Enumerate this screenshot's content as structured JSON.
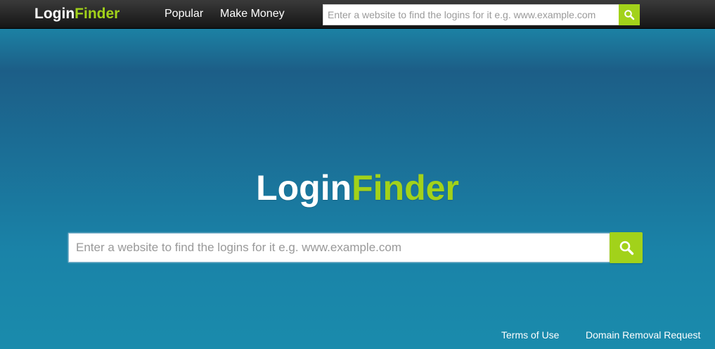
{
  "header": {
    "brand_login": "Login",
    "brand_finder": "Finder",
    "nav": {
      "popular": "Popular",
      "make_money": "Make Money"
    },
    "search": {
      "placeholder": "Enter a website to find the logins for it e.g. www.example.com",
      "icon": "search-icon"
    }
  },
  "hero": {
    "brand_login": "Login",
    "brand_finder": "Finder",
    "search": {
      "placeholder": "Enter a website to find the logins for it e.g. www.example.com",
      "icon": "search-icon"
    }
  },
  "footer": {
    "terms": "Terms of Use",
    "removal": "Domain Removal Request"
  },
  "colors": {
    "accent": "#a2d21a",
    "topbar": "#1f1f1f",
    "background": "#1b6c94"
  }
}
